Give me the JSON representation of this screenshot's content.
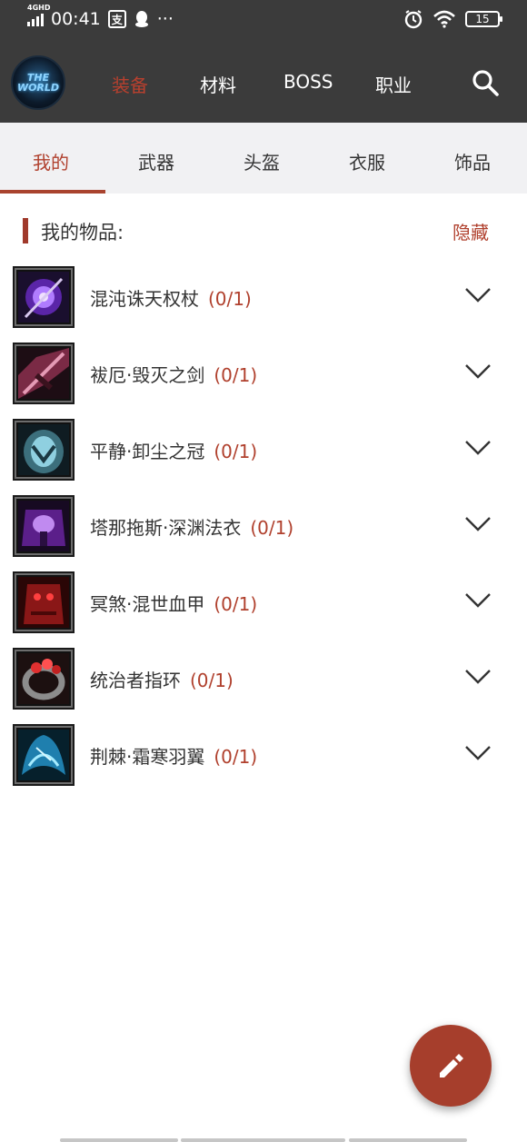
{
  "status_bar": {
    "network": "4GHD",
    "time": "00:41",
    "pay_icon_text": "支",
    "more": "···",
    "battery": "15"
  },
  "logo_text": "THE WORLD",
  "main_nav": {
    "tabs": [
      {
        "label": "装备",
        "active": true
      },
      {
        "label": "材料",
        "active": false
      },
      {
        "label": "BOSS",
        "active": false
      },
      {
        "label": "职业",
        "active": false
      }
    ]
  },
  "sub_tabs": [
    {
      "label": "我的",
      "active": true
    },
    {
      "label": "武器",
      "active": false
    },
    {
      "label": "头盔",
      "active": false
    },
    {
      "label": "衣服",
      "active": false
    },
    {
      "label": "饰品",
      "active": false
    }
  ],
  "section": {
    "title": "我的物品:",
    "hide_label": "隐藏"
  },
  "items": [
    {
      "name": "混沌诛天权杖",
      "count": "(0/1)",
      "icon": "scepter-icon",
      "color": "#8a3fe0"
    },
    {
      "name": "袚厄·毁灭之剑",
      "count": "(0/1)",
      "icon": "sword-icon",
      "color": "#c04a73"
    },
    {
      "name": "平静·卸尘之冠",
      "count": "(0/1)",
      "icon": "crown-icon",
      "color": "#5fa3b5"
    },
    {
      "name": "塔那拖斯·深渊法衣",
      "count": "(0/1)",
      "icon": "robe-icon",
      "color": "#9a3fd0"
    },
    {
      "name": "冥煞·混世血甲",
      "count": "(0/1)",
      "icon": "armor-icon",
      "color": "#c4282c"
    },
    {
      "name": "统治者指环",
      "count": "(0/1)",
      "icon": "ring-icon",
      "color": "#d0403a"
    },
    {
      "name": "荆棘·霜寒羽翼",
      "count": "(0/1)",
      "icon": "wings-icon",
      "color": "#3fb3e0"
    }
  ],
  "colors": {
    "accent": "#a63e2c",
    "topbar": "#3b3b3b",
    "subtab_bg": "#f1f1f3"
  }
}
